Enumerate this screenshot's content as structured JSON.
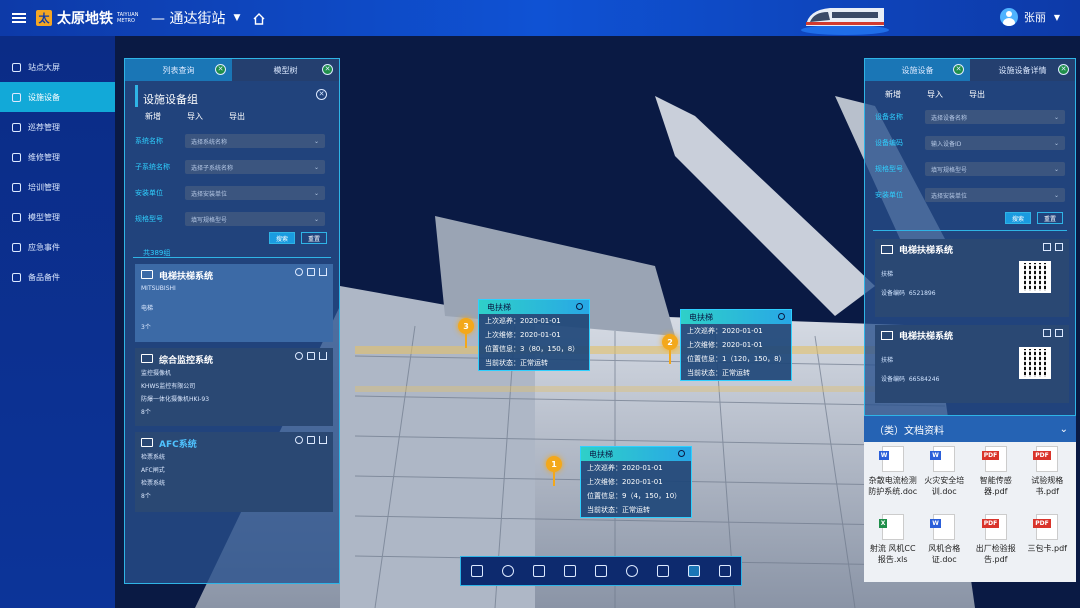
{
  "header": {
    "brand": "太原地铁",
    "brand_en": "TAIYUAN METRO",
    "station": "通达街站",
    "user": "张丽"
  },
  "sidebar": {
    "items": [
      {
        "label": "站点大屏",
        "active": false
      },
      {
        "label": "设施设备",
        "active": true
      },
      {
        "label": "巡荐管理",
        "active": false
      },
      {
        "label": "维修管理",
        "active": false
      },
      {
        "label": "培训管理",
        "active": false
      },
      {
        "label": "模型管理",
        "active": false
      },
      {
        "label": "应急事件",
        "active": false
      },
      {
        "label": "备品备件",
        "active": false
      }
    ]
  },
  "left_panel": {
    "tabs": [
      "列表查询",
      "模型树"
    ],
    "title": "设施设备组",
    "actions": [
      "新增",
      "导入",
      "导出"
    ],
    "filters": [
      {
        "label": "系统名称",
        "placeholder": "选择系统名称"
      },
      {
        "label": "子系统名称",
        "placeholder": "选择子系统名称"
      },
      {
        "label": "安装单位",
        "placeholder": "选择安装单位"
      },
      {
        "label": "规格型号",
        "placeholder": "填写规格型号"
      }
    ],
    "search": "搜索",
    "reset": "重置",
    "count": "共389组",
    "cards": [
      {
        "title": "电梯扶梯系统",
        "lines": [
          "MITSUBISHI",
          "电梯",
          "3个"
        ]
      },
      {
        "title": "综合监控系统",
        "lines": [
          "监控摄像机",
          "KHWS监控有限公司",
          "防爆一体化摄像机HKI-93",
          "8个"
        ]
      },
      {
        "title": "AFC系统",
        "lines": [
          "检票系统",
          "AFC闸式",
          "检票系统",
          "8个"
        ]
      }
    ]
  },
  "right_panel": {
    "tabs": [
      "设施设备",
      "设施设备详情"
    ],
    "actions": [
      "新增",
      "导入",
      "导出"
    ],
    "filters": [
      {
        "label": "设备名称",
        "placeholder": "选择设备名称"
      },
      {
        "label": "设备编码",
        "placeholder": "输入设备ID"
      },
      {
        "label": "规格型号",
        "placeholder": "填写规格型号"
      },
      {
        "label": "安装单位",
        "placeholder": "选择安装单位"
      }
    ],
    "search": "搜索",
    "reset": "重置",
    "cards": [
      {
        "title": "电梯扶梯系统",
        "type": "扶梯",
        "code_label": "设备编码",
        "code": "6521896"
      },
      {
        "title": "电梯扶梯系统",
        "type": "扶梯",
        "code_label": "设备编码",
        "code": "66584246"
      }
    ]
  },
  "docs": {
    "title": "（类）文档资料",
    "items": [
      {
        "name": "杂散电流检测防护系统.doc",
        "kind": "W"
      },
      {
        "name": "火灾安全培训.doc",
        "kind": "W"
      },
      {
        "name": "智能传感器.pdf",
        "kind": "PDF"
      },
      {
        "name": "试验规格书.pdf",
        "kind": "PDF"
      },
      {
        "name": "射流 风机CC报告.xls",
        "kind": "X"
      },
      {
        "name": "风机合格证.doc",
        "kind": "W"
      },
      {
        "name": "出厂检验报告.pdf",
        "kind": "PDF"
      },
      {
        "name": "三包卡.pdf",
        "kind": "PDF"
      }
    ]
  },
  "popups": [
    {
      "title": "电扶梯",
      "pin": "3",
      "lines": [
        "上次巡养：2020-01-01",
        "上次维修：2020-01-01",
        "位置信息：3（80，150，8）",
        "当前状态：正常运转"
      ]
    },
    {
      "title": "电扶梯",
      "pin": "2",
      "lines": [
        "上次巡养：2020-01-01",
        "上次维修：2020-01-01",
        "位置信息：1（120，150，8）",
        "当前状态：正常运转"
      ]
    },
    {
      "title": "电扶梯",
      "pin": "1",
      "lines": [
        "上次巡养：2020-01-01",
        "上次维修：2020-01-01",
        "位置信息：9（4，150，10）",
        "当前状态：正常运转"
      ]
    }
  ],
  "bottom_tools": [
    "layers-icon",
    "target-icon",
    "camera-icon",
    "measure-icon",
    "section-icon",
    "info-icon",
    "grid-icon",
    "device-icon",
    "doc-icon"
  ]
}
